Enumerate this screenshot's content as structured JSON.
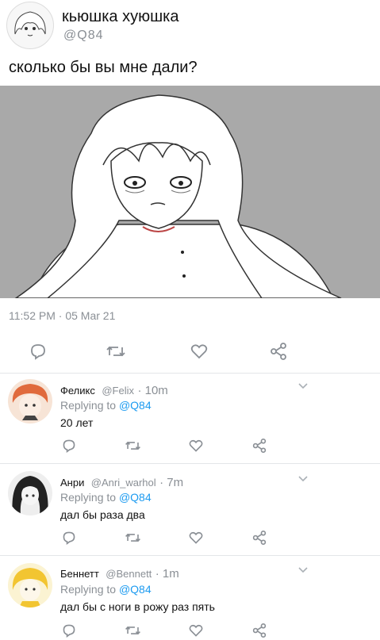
{
  "tweet": {
    "author_name": "кьюшка хуюшка",
    "author_handle": "@Q84",
    "text": "сколько бы вы мне дали?",
    "timestamp": "11:52 PM · 05 Mar 21",
    "image_description_icon": "manga-character-illustration"
  },
  "replies": [
    {
      "name": "Феликс",
      "handle": "@Felix",
      "time": "· 10m",
      "replying_label": "Replying to",
      "replying_handle": "@Q84",
      "text": "20 лет",
      "avatar_color": "#e06a3c"
    },
    {
      "name": "Анри",
      "handle": "@Anri_warhol",
      "time": "· 7m",
      "replying_label": "Replying to",
      "replying_handle": "@Q84",
      "text": "дал бы раза два",
      "avatar_color": "#222222"
    },
    {
      "name": "Беннетт",
      "handle": "@Bennett",
      "time": "· 1m",
      "replying_label": "Replying to",
      "replying_handle": "@Q84",
      "text": "дал бы с ноги в рожу раз пять",
      "avatar_color": "#f2c531"
    }
  ],
  "colors": {
    "icon_color": "#8a8f95",
    "link_blue": "#1d9bf0",
    "image_bg": "#a9a9a9"
  }
}
